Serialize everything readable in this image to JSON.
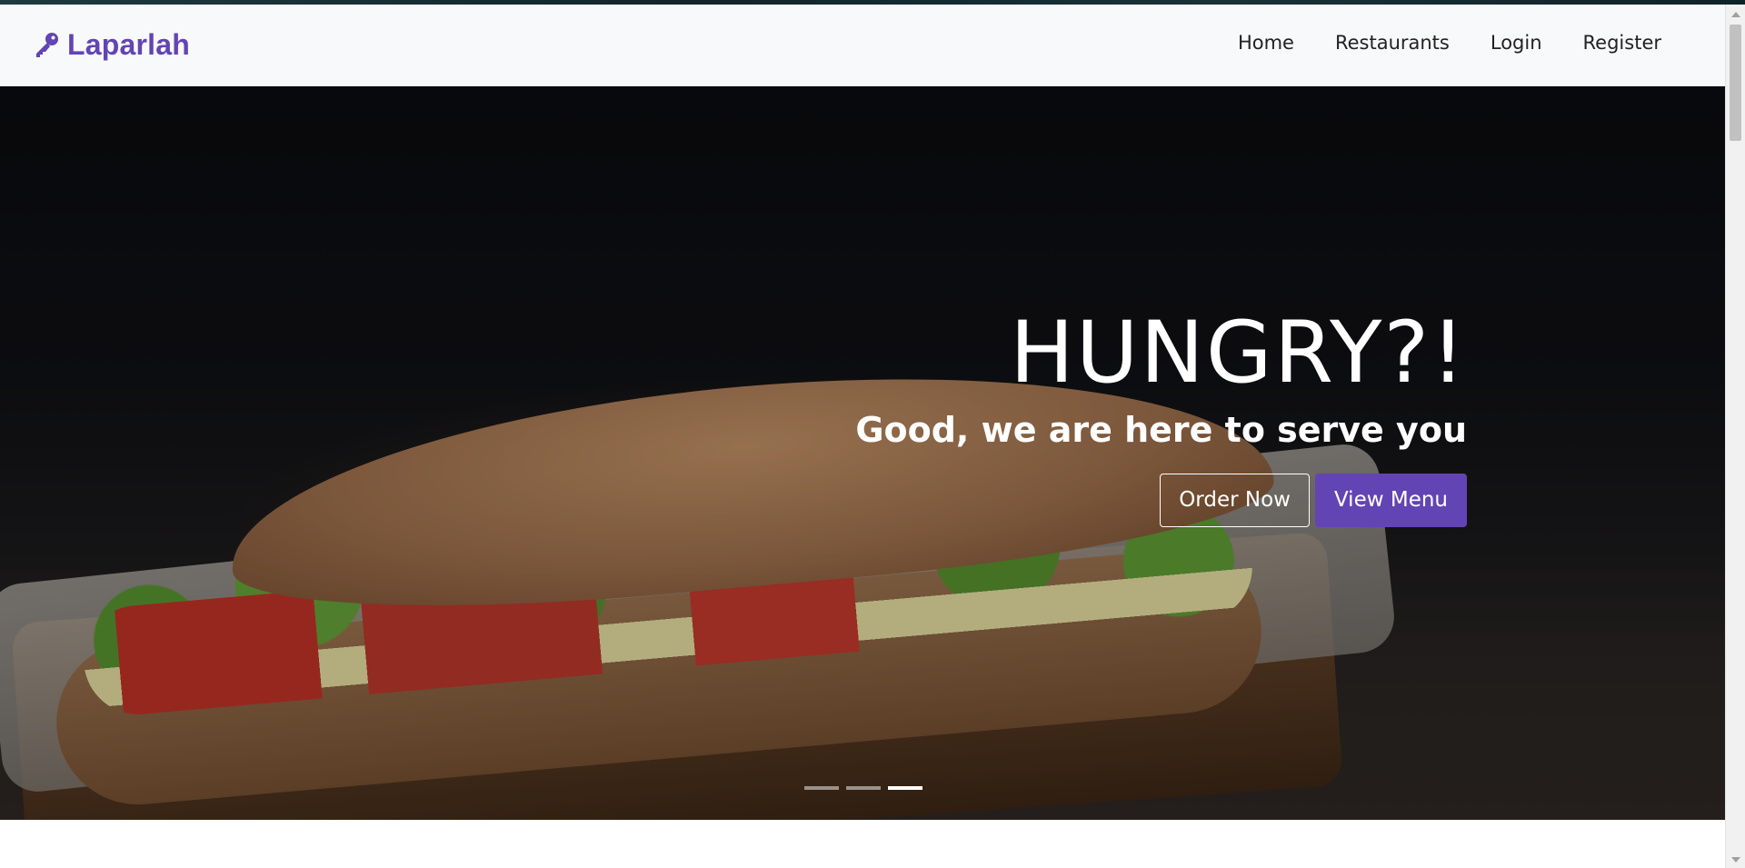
{
  "navbar": {
    "brand": "Laparlah",
    "brand_icon": "key-icon",
    "brand_color": "#6344b4",
    "links": [
      "Home",
      "Restaurants",
      "Login",
      "Register"
    ]
  },
  "hero": {
    "headline": "HUNGRY?!",
    "subline": "Good, we are here to serve you",
    "order_button": "Order Now",
    "menu_button": "View Menu",
    "slide_count": 3,
    "active_slide": 3,
    "image": "sandwich-photo"
  },
  "colors": {
    "accent": "#6344b4"
  }
}
